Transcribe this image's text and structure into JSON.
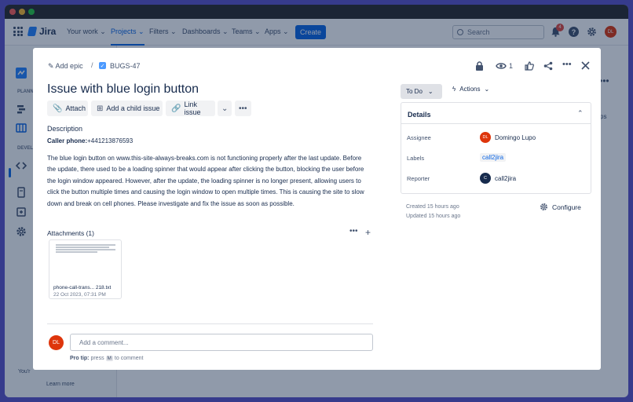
{
  "app": {
    "name": "Jira",
    "nav": [
      "Your work",
      "Projects",
      "Filters",
      "Dashboards",
      "Teams",
      "Apps"
    ],
    "create": "Create",
    "search_placeholder": "Search",
    "notifications_count": "4",
    "user_initials": "DL"
  },
  "sidebar": {
    "planning_label": "PLANN",
    "dev_label": "DEVEL",
    "footer_text": "You'r",
    "learn_more": "Learn more"
  },
  "background": {
    "peek_text": "ps"
  },
  "issue": {
    "add_epic": "Add epic",
    "key": "BUGS-47",
    "title": "Issue with blue login button",
    "watchers": "1",
    "toolbar": {
      "attach": "Attach",
      "add_child": "Add a child issue",
      "link_issue": "Link issue"
    },
    "description_heading": "Description",
    "caller_label": "Caller phone:",
    "caller_value": "+441213876593",
    "description": "The blue login button on www.this-site-always-breaks.com is not functioning properly after the last update. Before the update, there used to be a loading spinner that would appear after clicking the button, blocking the user before the login window appeared. However, after the update, the loading spinner is no longer present, allowing users to click the button multiple times and causing the login window to open multiple times. This is causing the site to slow down and break on cell phones. Please investigate and fix the issue as soon as possible.",
    "attachments_heading": "Attachments (1)",
    "attachment": {
      "name": "phone-call-trans... 218.txt",
      "date": "22 Oct 2023, 07:31 PM"
    },
    "comment_placeholder": "Add a comment...",
    "protip_label": "Pro tip:",
    "protip_press": "press",
    "protip_key": "M",
    "protip_rest": "to comment"
  },
  "side": {
    "status": "To Do",
    "actions": "Actions",
    "details_title": "Details",
    "assignee_label": "Assignee",
    "assignee_name": "Domingo Lupo",
    "assignee_initials": "DL",
    "labels_label": "Labels",
    "label_value": "call2jira",
    "reporter_label": "Reporter",
    "reporter_name": "call2jira",
    "reporter_initials": "C",
    "created": "Created 15 hours ago",
    "updated": "Updated 15 hours ago",
    "configure": "Configure"
  },
  "colors": {
    "frame": "#5b52c9",
    "accent": "#0c66e4",
    "avatar": "#de350b",
    "reporter_avatar": "#172b4d"
  }
}
